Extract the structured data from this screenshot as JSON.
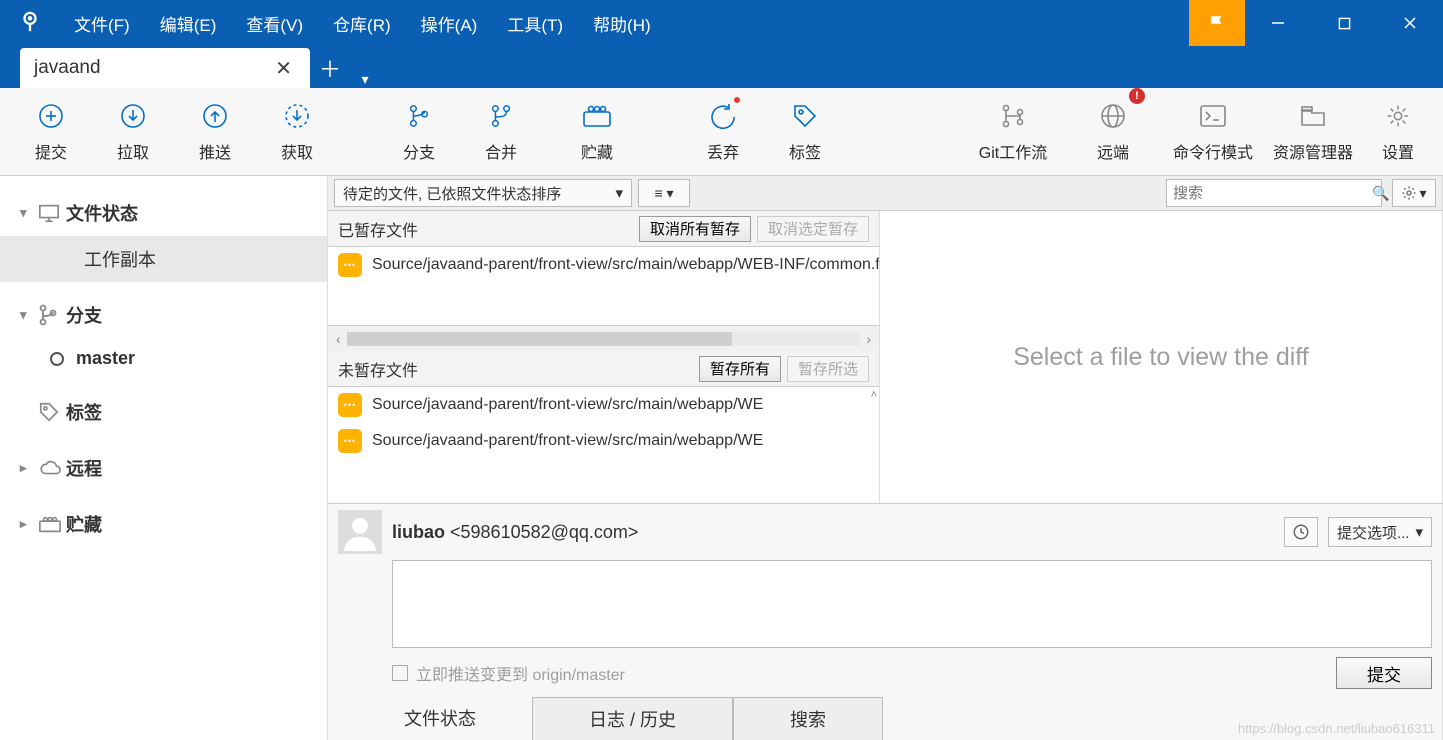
{
  "menus": [
    "文件(F)",
    "编辑(E)",
    "查看(V)",
    "仓库(R)",
    "操作(A)",
    "工具(T)",
    "帮助(H)"
  ],
  "tab": {
    "name": "javaand"
  },
  "toolbar": {
    "left": [
      {
        "label": "提交",
        "icon": "plus"
      },
      {
        "label": "拉取",
        "icon": "down"
      },
      {
        "label": "推送",
        "icon": "up"
      },
      {
        "label": "获取",
        "icon": "fetch"
      }
    ],
    "mid": [
      {
        "label": "分支",
        "icon": "branch"
      },
      {
        "label": "合并",
        "icon": "merge"
      },
      {
        "label": "贮藏",
        "icon": "stash"
      }
    ],
    "mid2": [
      {
        "label": "丢弃",
        "icon": "discard"
      },
      {
        "label": "标签",
        "icon": "tag"
      }
    ],
    "right": [
      {
        "label": "Git工作流",
        "icon": "flow"
      },
      {
        "label": "远端",
        "icon": "remote",
        "badge": "!"
      },
      {
        "label": "命令行模式",
        "icon": "cli"
      },
      {
        "label": "资源管理器",
        "icon": "explorer"
      },
      {
        "label": "设置",
        "icon": "settings"
      }
    ]
  },
  "sidebar": {
    "file_status": {
      "head": "文件状态",
      "items": [
        "工作副本"
      ]
    },
    "branches": {
      "head": "分支",
      "items": [
        "master"
      ]
    },
    "tags": {
      "head": "标签"
    },
    "remotes": {
      "head": "远程"
    },
    "stashes": {
      "head": "贮藏"
    }
  },
  "filter": {
    "text": "待定的文件, 已依照文件状态排序",
    "search_ph": "搜索"
  },
  "staged": {
    "title": "已暂存文件",
    "btn_unstage_all": "取消所有暂存",
    "btn_unstage_sel": "取消选定暂存",
    "files": [
      "Source/javaand-parent/front-view/src/main/webapp/WEB-INF/common.ftl"
    ]
  },
  "unstaged": {
    "title": "未暂存文件",
    "btn_stage_all": "暂存所有",
    "btn_stage_sel": "暂存所选",
    "files": [
      "Source/javaand-parent/front-view/src/main/webapp/WE",
      "Source/javaand-parent/front-view/src/main/webapp/WE"
    ]
  },
  "diff_empty": "Select a file to view the diff",
  "commit": {
    "author_name": "liubao",
    "author_email": "<598610582@qq.com>",
    "push_label": "立即推送变更到 origin/master",
    "options": "提交选项...",
    "submit": "提交"
  },
  "bottom_tabs": [
    "文件状态",
    "日志 / 历史",
    "搜索"
  ],
  "watermark": "https://blog.csdn.net/liubao616311"
}
